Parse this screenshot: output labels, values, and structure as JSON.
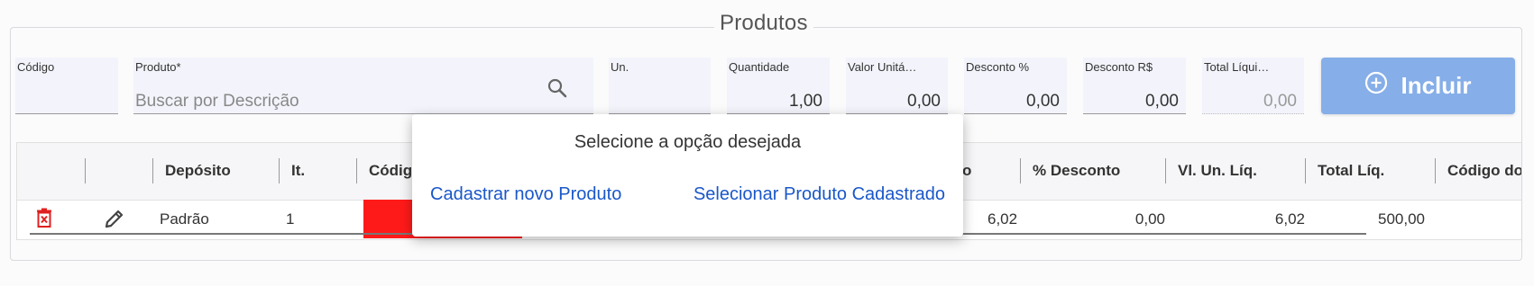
{
  "section": {
    "title": "Produtos"
  },
  "form": {
    "codigo": {
      "label": "Código",
      "value": ""
    },
    "produto": {
      "label": "Produto*",
      "placeholder": "Buscar por Descrição"
    },
    "unidade": {
      "label": "Un.",
      "value": ""
    },
    "quantidade": {
      "label": "Quantidade",
      "value": "1,00"
    },
    "valor_unitario": {
      "label": "Valor Unitá…",
      "value": "0,00"
    },
    "desconto_pct": {
      "label": "Desconto %",
      "value": "0,00"
    },
    "desconto_rs": {
      "label": "Desconto R$",
      "value": "0,00"
    },
    "total_liquido": {
      "label": "Total Líqui…",
      "value": "0,00"
    },
    "incluir_label": "Incluir"
  },
  "grid": {
    "headers": {
      "deposito": "Depósito",
      "item": "It.",
      "codigo": "Código",
      "preco_suffix": "o",
      "desconto": "% Desconto",
      "vl_un_liq": "Vl. Un. Líq.",
      "total_liq": "Total Líq.",
      "codigo_do": "Código do"
    },
    "rows": [
      {
        "deposito": "Padrão",
        "item": "1",
        "preco": "6,02",
        "desconto": "0,00",
        "vl_un_liq": "6,02",
        "total_liq": "500,00"
      }
    ]
  },
  "popup": {
    "title": "Selecione a opção desejada",
    "option_new": "Cadastrar novo Produto",
    "option_select": "Selecionar Produto Cadastrado"
  },
  "colors": {
    "accent_button": "#86aee8",
    "link": "#1a57c9",
    "delete": "#e02020",
    "highlight_cell": "#ff1a1a"
  },
  "icons": {
    "search": "search-icon",
    "add": "plus-circle-icon",
    "delete": "trash-icon",
    "edit": "pencil-icon"
  }
}
